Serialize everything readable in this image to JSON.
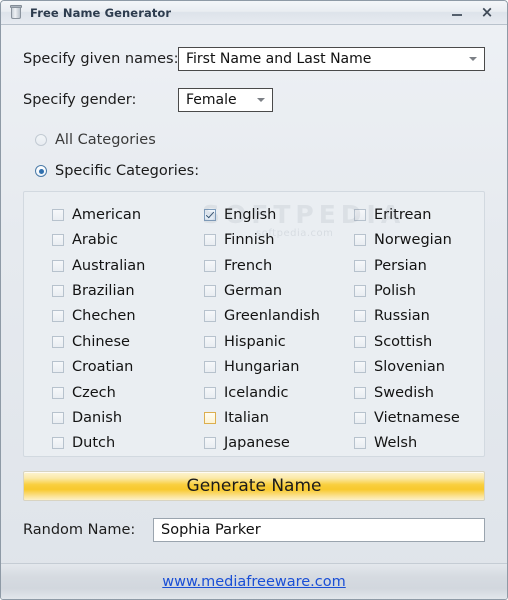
{
  "window": {
    "title": "Free Name Generator",
    "icon": "app-bin-icon",
    "minimize_label": "–",
    "close_label": "×"
  },
  "form": {
    "given_names": {
      "label": "Specify given names:",
      "value": "First Name and Last Name"
    },
    "gender": {
      "label": "Specify gender:",
      "value": "Female"
    }
  },
  "category_mode": {
    "all": {
      "label": "All Categories",
      "selected": false
    },
    "specific": {
      "label": "Specific Categories:",
      "selected": true
    }
  },
  "categories": {
    "column1": [
      {
        "label": "American",
        "checked": false,
        "hover": false
      },
      {
        "label": "Arabic",
        "checked": false,
        "hover": false
      },
      {
        "label": "Australian",
        "checked": false,
        "hover": false
      },
      {
        "label": "Brazilian",
        "checked": false,
        "hover": false
      },
      {
        "label": "Chechen",
        "checked": false,
        "hover": false
      },
      {
        "label": "Chinese",
        "checked": false,
        "hover": false
      },
      {
        "label": "Croatian",
        "checked": false,
        "hover": false
      },
      {
        "label": "Czech",
        "checked": false,
        "hover": false
      },
      {
        "label": "Danish",
        "checked": false,
        "hover": false
      },
      {
        "label": "Dutch",
        "checked": false,
        "hover": false
      }
    ],
    "column2": [
      {
        "label": "English",
        "checked": true,
        "hover": false
      },
      {
        "label": "Finnish",
        "checked": false,
        "hover": false
      },
      {
        "label": "French",
        "checked": false,
        "hover": false
      },
      {
        "label": "German",
        "checked": false,
        "hover": false
      },
      {
        "label": "Greenlandish",
        "checked": false,
        "hover": false
      },
      {
        "label": "Hispanic",
        "checked": false,
        "hover": false
      },
      {
        "label": "Hungarian",
        "checked": false,
        "hover": false
      },
      {
        "label": "Icelandic",
        "checked": false,
        "hover": false
      },
      {
        "label": "Italian",
        "checked": false,
        "hover": true
      },
      {
        "label": "Japanese",
        "checked": false,
        "hover": false
      }
    ],
    "column3": [
      {
        "label": "Eritrean",
        "checked": false,
        "hover": false
      },
      {
        "label": "Norwegian",
        "checked": false,
        "hover": false
      },
      {
        "label": "Persian",
        "checked": false,
        "hover": false
      },
      {
        "label": "Polish",
        "checked": false,
        "hover": false
      },
      {
        "label": "Russian",
        "checked": false,
        "hover": false
      },
      {
        "label": "Scottish",
        "checked": false,
        "hover": false
      },
      {
        "label": "Slovenian",
        "checked": false,
        "hover": false
      },
      {
        "label": "Swedish",
        "checked": false,
        "hover": false
      },
      {
        "label": "Vietnamese",
        "checked": false,
        "hover": false
      },
      {
        "label": "Welsh",
        "checked": false,
        "hover": false
      }
    ]
  },
  "generate_button": {
    "label": "Generate Name"
  },
  "random_name": {
    "label": "Random Name:",
    "value": "Sophia Parker"
  },
  "footer": {
    "link_text": "www.mediafreeware.com"
  },
  "watermark": {
    "main": "SOFTPEDIA",
    "sub": "softpedia.com"
  },
  "colors": {
    "accent_button": "#f8c92c",
    "link": "#1a4fd6",
    "radio_selected": "#2f6fae",
    "hover_checkbox": "#dcae4e"
  }
}
